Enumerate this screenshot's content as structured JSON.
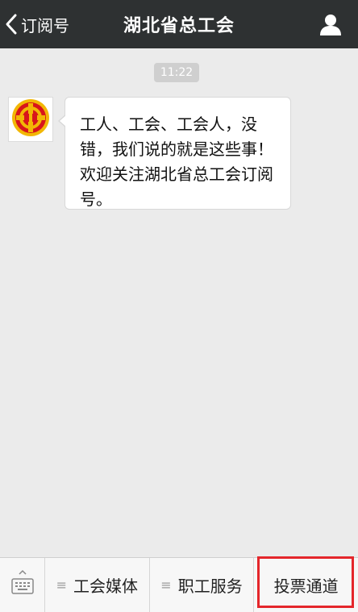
{
  "header": {
    "back_label": "订阅号",
    "title": "湖北省总工会",
    "back_icon": "chevron-left-icon",
    "profile_icon": "person-icon"
  },
  "chat": {
    "timestamp": "11:22",
    "avatar_icon": "union-logo-icon",
    "message": "工人、工会、工会人，没错，我们说的就是这些事！欢迎关注湖北省总工会订阅号。"
  },
  "menu": {
    "keyboard_icon": "keyboard-icon",
    "items": [
      {
        "label": "工会媒体",
        "icon": "list-icon"
      },
      {
        "label": "职工服务",
        "icon": "list-icon"
      },
      {
        "label": "投票通道"
      }
    ]
  },
  "colors": {
    "header_bg": "#2e3132",
    "chat_bg": "#ebebeb",
    "highlight": "#e4262b",
    "logo_red": "#d8151b",
    "logo_yellow": "#f2b705"
  }
}
